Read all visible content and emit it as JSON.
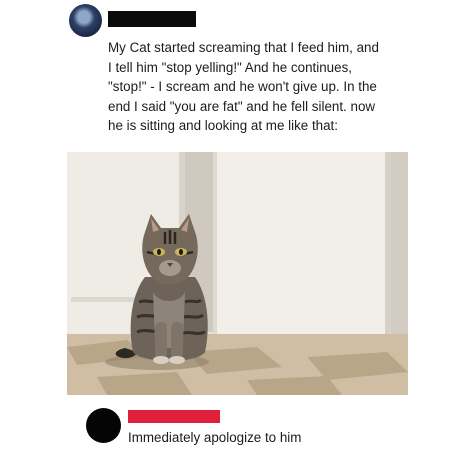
{
  "post": {
    "author_avatar_icon": "profile-avatar",
    "author_name_redacted": true,
    "text": "My Cat started screaming that I feed him, and\nI tell him \"stop yelling!\" And he continues,\n\"stop!\" - I scream and he won't give up. In the\nend I said \"you are fat\" and he fell silent. now\nhe is sitting and looking at me like that:",
    "image": {
      "subject": "tabby-cat-sitting-on-tile-floor",
      "colors": {
        "wall": "#e6e2dc",
        "fridge": "#f1eee8",
        "floor": "#cdb89a"
      }
    }
  },
  "comment": {
    "avatar_icon": "profile-avatar",
    "name_redacted_color": "#e0203a",
    "text": "Immediately apologize to him"
  }
}
